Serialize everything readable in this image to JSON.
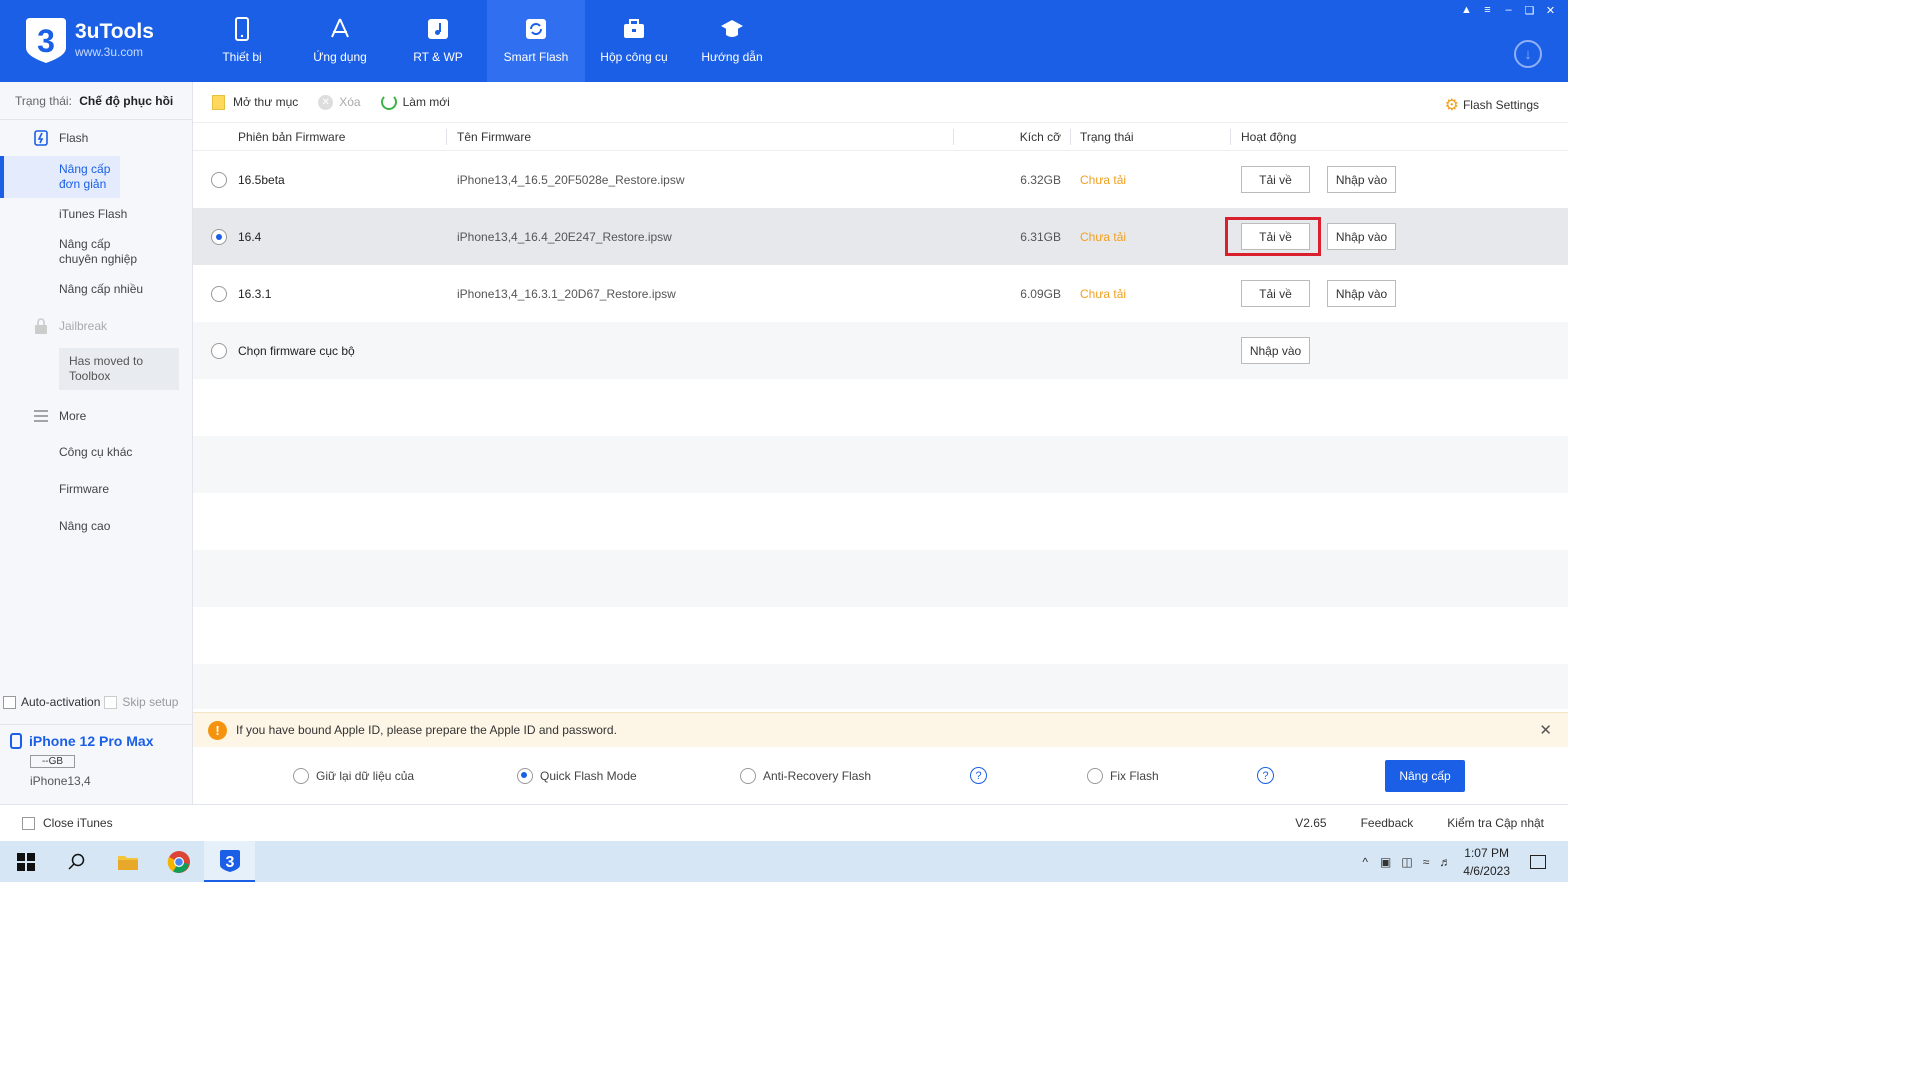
{
  "app": {
    "name": "3uTools",
    "url": "www.3u.com"
  },
  "nav": [
    {
      "label": "Thiết bị",
      "icon": "phone-icon"
    },
    {
      "label": "Ứng dụng",
      "icon": "app-store-icon"
    },
    {
      "label": "RT & WP",
      "icon": "music-icon"
    },
    {
      "label": "Smart Flash",
      "icon": "refresh-icon",
      "active": true
    },
    {
      "label": "Hộp công cụ",
      "icon": "toolbox-icon"
    },
    {
      "label": "Hướng dẫn",
      "icon": "graduation-cap-icon"
    }
  ],
  "sidebar": {
    "status_label": "Trạng thái:",
    "status_value": "Chế độ phục hồi",
    "flash_label": "Flash",
    "items": [
      "Nâng cấp đơn giản",
      "iTunes Flash",
      "Nâng cấp chuyên nghiệp",
      "Nâng cấp nhiều"
    ],
    "jailbreak_label": "Jailbreak",
    "moved_note": "Has moved to Toolbox",
    "more_label": "More",
    "more_items": [
      "Công cụ khác",
      "Firmware",
      "Nâng cao"
    ],
    "auto_activation": "Auto-activation",
    "skip_setup": "Skip setup",
    "device_name": "iPhone 12 Pro Max",
    "device_storage": "--GB",
    "device_model": "iPhone13,4"
  },
  "toolbar": {
    "open_folder": "Mở thư mục",
    "delete": "Xóa",
    "refresh": "Làm mới",
    "flash_settings": "Flash Settings"
  },
  "table": {
    "headers": [
      "Phiên bản Firmware",
      "Tên Firmware",
      "Kích cỡ",
      "Trạng thái",
      "Hoạt động"
    ],
    "rows": [
      {
        "version": "16.5beta",
        "name": "iPhone13,4_16.5_20F5028e_Restore.ipsw",
        "size": "6.32GB",
        "status": "Chưa tải",
        "selected": false
      },
      {
        "version": "16.4",
        "name": "iPhone13,4_16.4_20E247_Restore.ipsw",
        "size": "6.31GB",
        "status": "Chưa tải",
        "selected": true
      },
      {
        "version": "16.3.1",
        "name": "iPhone13,4_16.3.1_20D67_Restore.ipsw",
        "size": "6.09GB",
        "status": "Chưa tải",
        "selected": false
      }
    ],
    "local_row": "Chọn firmware cục bộ",
    "download_label": "Tải về",
    "import_label": "Nhập vào"
  },
  "info_bar": {
    "text": "If you have bound Apple ID, please prepare the Apple ID and password."
  },
  "modes": {
    "keep_data": "Giữ lại dữ liệu của",
    "quick_flash": "Quick Flash Mode",
    "anti_recovery": "Anti-Recovery Flash",
    "fix_flash": "Fix Flash",
    "upgrade_button": "Nâng cấp",
    "help": "?"
  },
  "bottom": {
    "close_itunes": "Close iTunes",
    "version": "V2.65",
    "feedback": "Feedback",
    "check_update": "Kiểm tra Cập nhật"
  },
  "taskbar": {
    "time": "1:07 PM",
    "date": "4/6/2023"
  },
  "colors": {
    "brand": "#1a5fe6",
    "status": "#f0a020",
    "highlight": "#d9202c"
  }
}
